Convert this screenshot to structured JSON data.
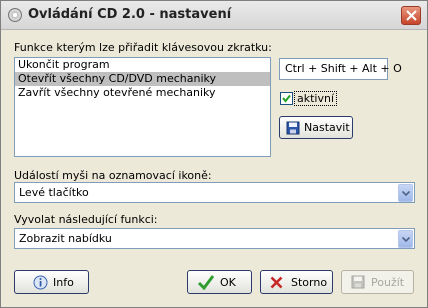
{
  "window": {
    "title": "Ovládání CD 2.0 - nastavení"
  },
  "functions": {
    "label": "Funkce kterým lze přiřadit klávesovou zkratku:",
    "items": [
      {
        "label": "Ukončit program",
        "selected": false
      },
      {
        "label": "Otevřít všechny CD/DVD mechaniky",
        "selected": true
      },
      {
        "label": "Zavřít všechny otevřené mechaniky",
        "selected": false
      }
    ]
  },
  "hotkey": {
    "value": "Ctrl + Shift + Alt + O"
  },
  "active": {
    "label": "aktivní",
    "checked": true
  },
  "set_button": {
    "label": "Nastavit"
  },
  "mouse_event": {
    "label": "Událostí myši na oznamovací ikoně:",
    "selected": "Levé tlačítko"
  },
  "invoke_function": {
    "label": "Vyvolat následující funkci:",
    "selected": "Zobrazit nabídku"
  },
  "buttons": {
    "info": "Info",
    "ok": "OK",
    "cancel": "Storno",
    "apply": "Použít"
  },
  "colors": {
    "ok_check": "#2f9e2f",
    "cancel_x": "#c62828",
    "selection": "#bfbfbf",
    "border": "#7f9db9"
  }
}
